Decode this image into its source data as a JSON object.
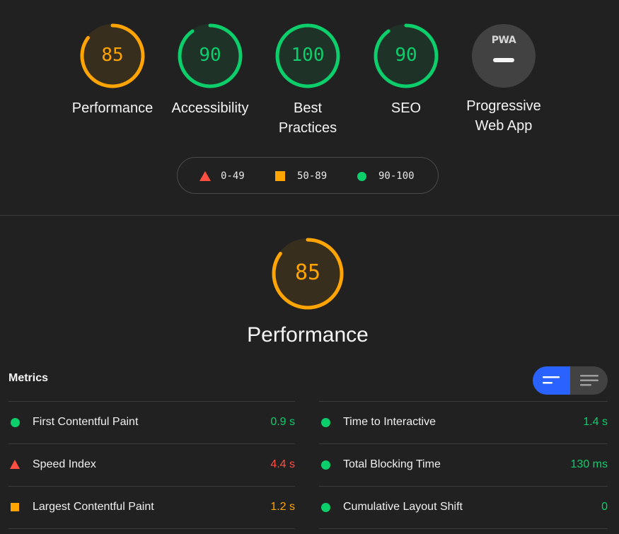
{
  "colors": {
    "pass": "#0cce6b",
    "average": "#ffa400",
    "fail": "#ff4e42",
    "background": "#212121",
    "toggle_active": "#2962ff"
  },
  "categories": [
    {
      "label": "Performance",
      "score": 85,
      "level": "average"
    },
    {
      "label": "Accessibility",
      "score": 90,
      "level": "pass"
    },
    {
      "label": "Best Practices",
      "score": 100,
      "level": "pass"
    },
    {
      "label": "SEO",
      "score": 90,
      "level": "pass"
    },
    {
      "label": "Progressive Web App",
      "logo_text": "PWA",
      "level": "na"
    }
  ],
  "legend": [
    {
      "range": "0-49",
      "shape": "triangle",
      "level": "fail"
    },
    {
      "range": "50-89",
      "shape": "square",
      "level": "average"
    },
    {
      "range": "90-100",
      "shape": "circle",
      "level": "pass"
    }
  ],
  "performance": {
    "title": "Performance",
    "score": 85
  },
  "metrics": {
    "title": "Metrics",
    "view_toggle": {
      "options": [
        "collapsed-view",
        "expanded-view"
      ],
      "active": "collapsed-view"
    },
    "left": [
      {
        "name": "First Contentful Paint",
        "value": "0.9 s",
        "level": "pass"
      },
      {
        "name": "Speed Index",
        "value": "4.4 s",
        "level": "fail"
      },
      {
        "name": "Largest Contentful Paint",
        "value": "1.2 s",
        "level": "average"
      }
    ],
    "right": [
      {
        "name": "Time to Interactive",
        "value": "1.4 s",
        "level": "pass"
      },
      {
        "name": "Total Blocking Time",
        "value": "130 ms",
        "level": "pass"
      },
      {
        "name": "Cumulative Layout Shift",
        "value": "0",
        "level": "pass"
      }
    ]
  }
}
